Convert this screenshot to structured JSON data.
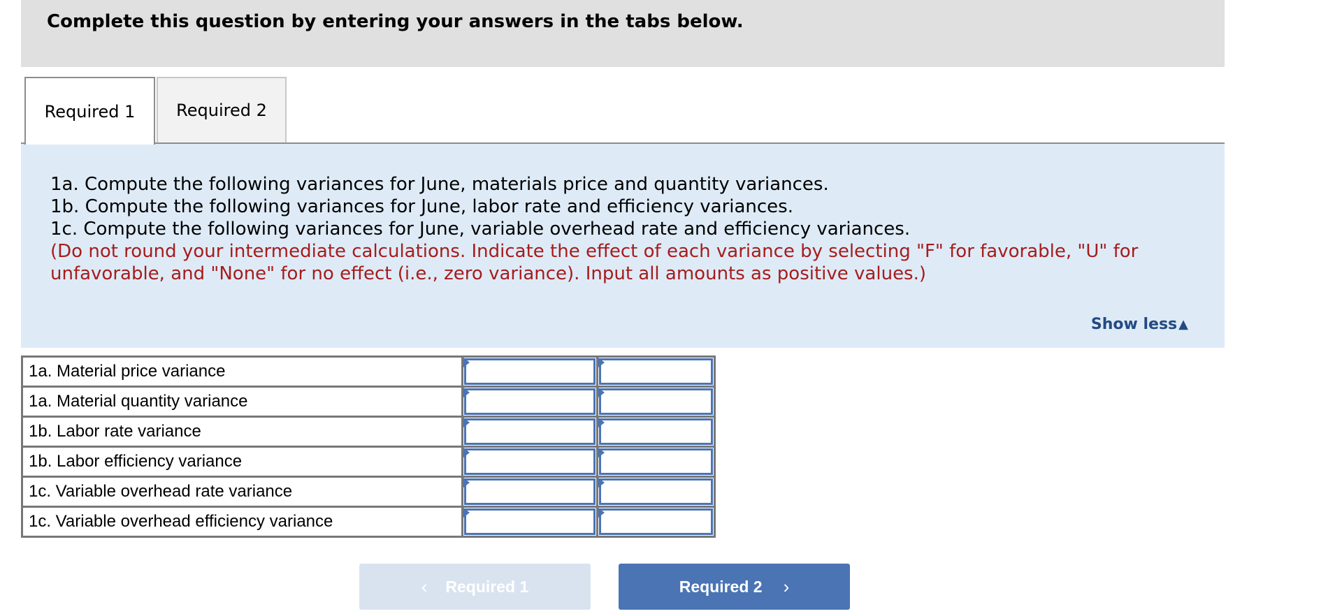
{
  "header": {
    "title": "Complete this question by entering your answers in the tabs below."
  },
  "tabs": [
    {
      "label": "Required 1",
      "active": true
    },
    {
      "label": "Required 2",
      "active": false
    }
  ],
  "instructions": {
    "lines": [
      "1a. Compute the following variances for June, materials price and quantity variances.",
      "1b. Compute the following variances for June, labor rate and efficiency variances.",
      "1c. Compute the following variances for June, variable overhead rate and efficiency variances."
    ],
    "note": "(Do not round your intermediate calculations. Indicate the effect of each variance by selecting \"F\" for favorable, \"U\" for unfavorable, and \"None\" for no effect (i.e., zero variance). Input all amounts as positive values.)",
    "note_color": "#a61c1c",
    "toggle_label": "Show less",
    "toggle_icon": "▲"
  },
  "table": {
    "rows": [
      {
        "label": "1a. Material price variance",
        "amount": "",
        "effect": ""
      },
      {
        "label": "1a. Material quantity variance",
        "amount": "",
        "effect": ""
      },
      {
        "label": "1b. Labor rate variance",
        "amount": "",
        "effect": ""
      },
      {
        "label": "1b. Labor efficiency variance",
        "amount": "",
        "effect": ""
      },
      {
        "label": "1c. Variable overhead rate variance",
        "amount": "",
        "effect": ""
      },
      {
        "label": "1c. Variable overhead efficiency variance",
        "amount": "",
        "effect": ""
      }
    ]
  },
  "nav": {
    "prev_label": "Required 1",
    "prev_icon": "‹",
    "next_label": "Required 2",
    "next_icon": "›",
    "accent": "#4a74b4"
  }
}
